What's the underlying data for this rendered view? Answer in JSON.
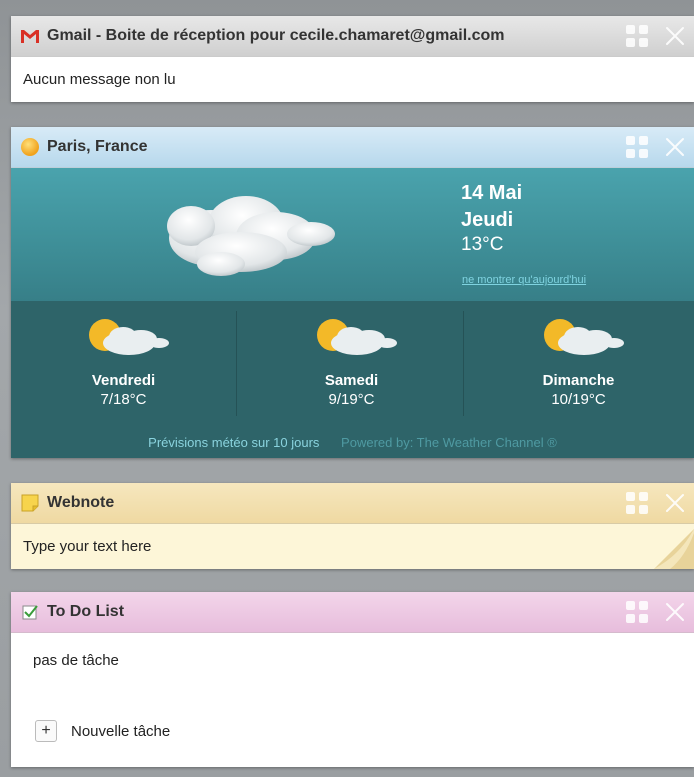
{
  "gmail": {
    "title": "Gmail - Boite de réception pour cecile.chamaret@gmail.com",
    "message": "Aucun message non lu"
  },
  "weather": {
    "title": "Paris, France",
    "today": {
      "date": "14 Mai",
      "day": "Jeudi",
      "temp": "13°C",
      "icon": "cloud-icon",
      "link": "ne montrer qu'aujourd'hui"
    },
    "forecast": [
      {
        "day": "Vendredi",
        "temp": "7/18°C",
        "icon": "partly-sunny-icon"
      },
      {
        "day": "Samedi",
        "temp": "9/19°C",
        "icon": "partly-sunny-icon"
      },
      {
        "day": "Dimanche",
        "temp": "10/19°C",
        "icon": "partly-sunny-icon"
      }
    ],
    "ten_day_link": "Prévisions météo sur 10 jours",
    "powered_by": "Powered by: The Weather Channel ®"
  },
  "webnote": {
    "title": "Webnote",
    "placeholder": "Type your text here"
  },
  "todo": {
    "title": "To Do List",
    "empty": "pas de tâche",
    "add_label": "Nouvelle tâche"
  },
  "colors": {
    "gmail_header": "#d6d6d6",
    "weather_header": "#c4dff0",
    "weather_bg": "#2f6f74",
    "webnote_header": "#f2dfae",
    "webnote_bg": "#fdf6d8",
    "todo_header": "#ecc6e2"
  }
}
